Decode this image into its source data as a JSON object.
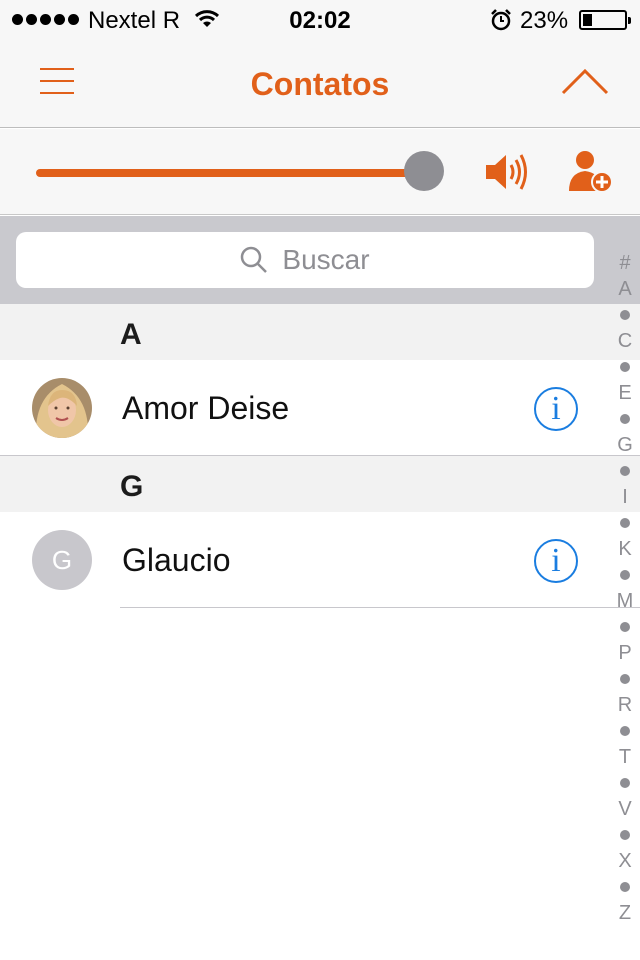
{
  "status_bar": {
    "carrier": "Nextel R",
    "time": "02:02",
    "battery_percent": "23%",
    "battery_level": 0.23
  },
  "nav": {
    "title": "Contatos",
    "menu_icon": "hamburger-icon",
    "collapse_icon": "chevron-up-icon"
  },
  "controls": {
    "volume_level": 0.97,
    "speaker_icon": "speaker-icon",
    "add_contact_icon": "add-contact-icon"
  },
  "search": {
    "placeholder": "Buscar"
  },
  "sections": [
    {
      "letter": "A",
      "contacts": [
        {
          "name": "Amor Deise",
          "avatar": "photo"
        }
      ]
    },
    {
      "letter": "G",
      "contacts": [
        {
          "name": "Glaucio",
          "avatar": "G"
        }
      ]
    }
  ],
  "index": [
    "#",
    "A",
    "•",
    "C",
    "•",
    "E",
    "•",
    "G",
    "•",
    "I",
    "•",
    "K",
    "•",
    "M",
    "•",
    "P",
    "•",
    "R",
    "•",
    "T",
    "•",
    "V",
    "•",
    "X",
    "•",
    "Z"
  ],
  "colors": {
    "accent": "#e1601a",
    "info_blue": "#1a7de0",
    "avatar_gray": "#c8c7cc"
  }
}
